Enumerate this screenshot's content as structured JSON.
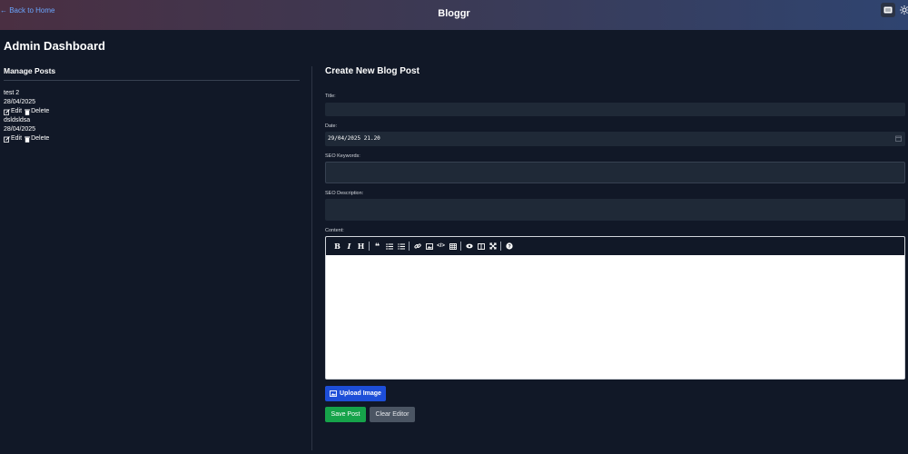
{
  "header": {
    "back_label": "← Back to Home",
    "brand": "Bloggr",
    "theme_icon": "book-icon",
    "settings_icon": "sun-icon"
  },
  "page": {
    "title": "Admin Dashboard"
  },
  "manage": {
    "title": "Manage Posts",
    "posts": [
      {
        "title": "test 2",
        "date": "28/04/2025",
        "edit_label": "Edit",
        "delete_label": "Delete"
      },
      {
        "title": "dsldsldsa",
        "date": "28/04/2025",
        "edit_label": "Edit",
        "delete_label": "Delete"
      }
    ]
  },
  "form": {
    "title": "Create New Blog Post",
    "title_label": "Title:",
    "title_value": "",
    "date_label": "Date:",
    "date_value": "29/04/2025 21.20",
    "seo_keywords_label": "SEO Keywords:",
    "seo_keywords_value": "",
    "seo_description_label": "SEO Description:",
    "seo_description_value": "",
    "content_label": "Content:",
    "toolbar": [
      "bold-icon",
      "italic-icon",
      "heading-icon",
      "quote-icon",
      "unordered-list-icon",
      "ordered-list-icon",
      "link-icon",
      "image-icon",
      "code-icon",
      "table-icon",
      "preview-icon",
      "side-by-side-icon",
      "fullscreen-icon",
      "help-icon"
    ],
    "upload_label": "Upload Image",
    "save_label": "Save Post",
    "clear_label": "Clear Editor"
  },
  "colors": {
    "background": "#111827",
    "field": "#1f2937",
    "link": "#6aa6ff",
    "upload": "#1d4ed8",
    "save": "#16a34a",
    "clear": "#4b5563"
  }
}
